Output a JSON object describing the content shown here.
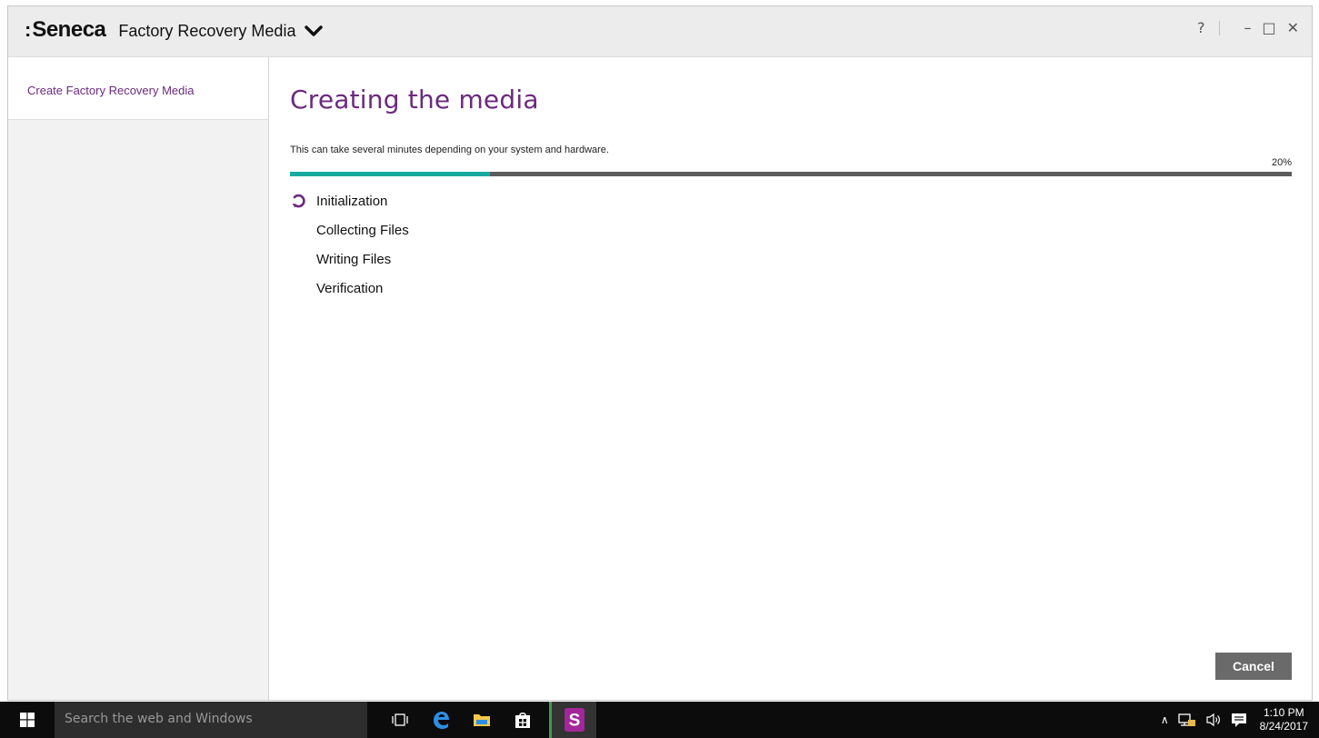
{
  "titlebar": {
    "brand_prefix": ":",
    "brand_name": "Seneca",
    "app_title": "Factory Recovery Media",
    "help": "?",
    "minimize": "–",
    "maximize": "□",
    "close": "✕"
  },
  "sidebar": {
    "items": [
      {
        "label": "Create Factory Recovery Media",
        "active": true
      }
    ]
  },
  "main": {
    "heading": "Creating the media",
    "subtitle": "This can take several minutes depending on your system and hardware.",
    "progress_percent": 20,
    "progress_label": "20%",
    "steps": [
      {
        "label": "Initialization",
        "state": "in-progress",
        "icon": "spinner-icon"
      },
      {
        "label": "Collecting Files",
        "state": "pending"
      },
      {
        "label": "Writing Files",
        "state": "pending"
      },
      {
        "label": "Verification",
        "state": "pending"
      }
    ],
    "cancel_label": "Cancel"
  },
  "taskbar": {
    "search_placeholder": "Search the web and Windows",
    "icons": [
      "windows-start-icon",
      "task-view-icon",
      "edge-icon",
      "file-explorer-icon",
      "store-icon",
      "seneca-app-icon"
    ],
    "tray": {
      "chevron": "∧",
      "icons": [
        "network-icon",
        "volume-icon",
        "notifications-icon"
      ],
      "time": "1:10 PM",
      "date": "8/24/2017"
    }
  },
  "colors": {
    "accent_purple": "#6b2a7f",
    "progress_fill": "#17aaa0",
    "progress_track": "#5c5c5c",
    "button_gray": "#6a6a6a"
  }
}
